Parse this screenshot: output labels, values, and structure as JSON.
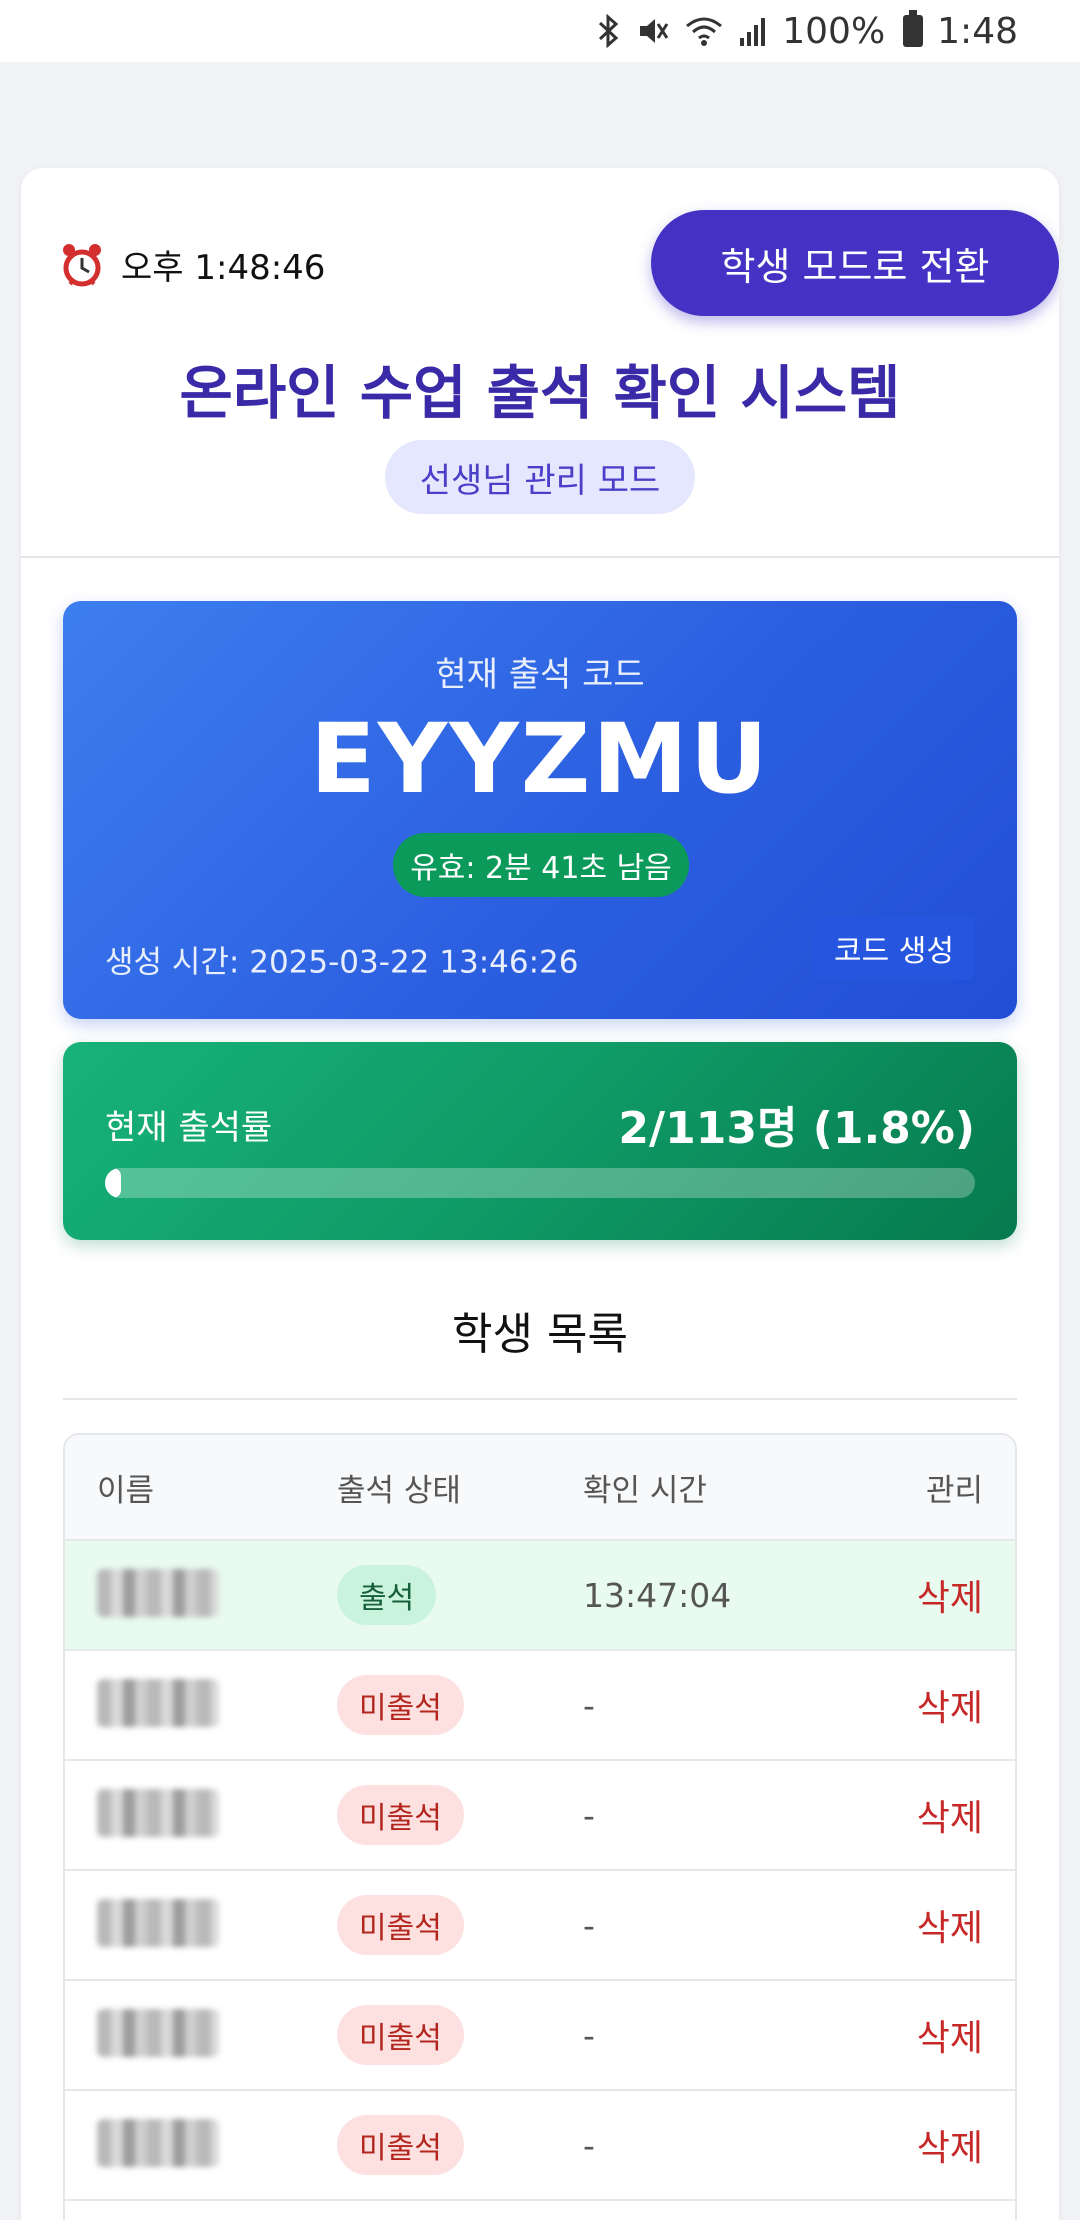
{
  "status_bar": {
    "battery": "100%",
    "time": "1:48"
  },
  "header": {
    "clock": "오후 1:48:46",
    "mode_button": "학생 모드로 전환",
    "title": "온라인 수업 출석 확인 시스템",
    "mode_badge": "선생님 관리 모드"
  },
  "code_card": {
    "label": "현재 출석 코드",
    "code": "EYYZMU",
    "validity": "유효: 2분 41초 남음",
    "generated": "생성 시간: 2025-03-22 13:46:26",
    "generate_button": "코드 생성"
  },
  "rate_card": {
    "label": "현재 출석률",
    "value": "2/113명 (1.8%)",
    "progress_fraction": 0.018
  },
  "student_list": {
    "title": "학생 목록",
    "headers": [
      "이름",
      "출석 상태",
      "확인 시간",
      "관리"
    ],
    "rows": [
      {
        "status": "출석",
        "time": "13:47:04",
        "action": "삭제"
      },
      {
        "status": "미출석",
        "time": "-",
        "action": "삭제"
      },
      {
        "status": "미출석",
        "time": "-",
        "action": "삭제"
      },
      {
        "status": "미출석",
        "time": "-",
        "action": "삭제"
      },
      {
        "status": "미출석",
        "time": "-",
        "action": "삭제"
      },
      {
        "status": "미출석",
        "time": "-",
        "action": "삭제"
      }
    ]
  },
  "colors": {
    "brand": "#4532c4",
    "code_card": "#2c5fe0",
    "rate_card": "#0f9a66",
    "delete": "#c62828"
  }
}
